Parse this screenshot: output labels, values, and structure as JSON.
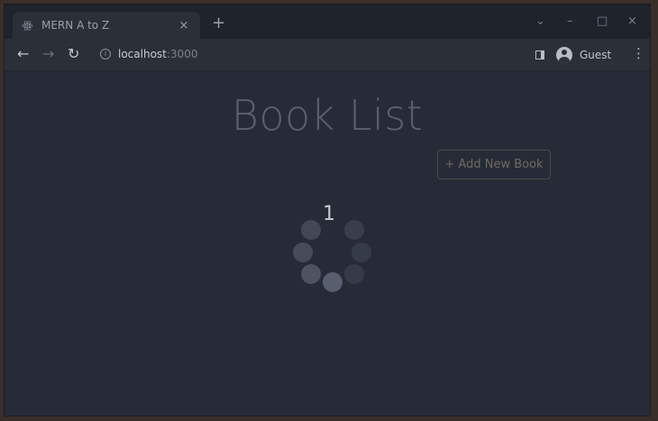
{
  "browser": {
    "tab_title": "MERN A to Z",
    "tab_close": "×",
    "new_tab": "+",
    "url_host": "localhost",
    "url_port": ":3000",
    "profile_label": "Guest",
    "window_controls": {
      "dropdown": "⌄",
      "minimize": "–",
      "maximize": "□",
      "close": "×"
    },
    "nav": {
      "back": "←",
      "forward": "→",
      "reload": "↻"
    },
    "icons": [
      "tab-favicon-icon",
      "info-icon",
      "side-panel-icon",
      "profile-icon",
      "kebab-menu-icon"
    ]
  },
  "page": {
    "title": "Book List",
    "add_button_label": "+ Add New Book",
    "loading_text": "1"
  },
  "colors": {
    "page_background": "#262b37",
    "title_text": "#5b606c",
    "button_border": "#4f4a42",
    "spinner_dot": "#5c6070"
  }
}
